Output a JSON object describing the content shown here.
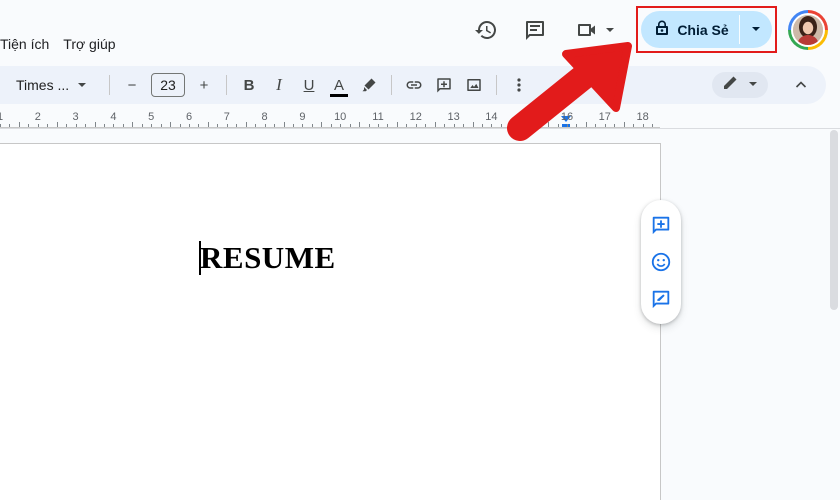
{
  "menu": {
    "items": [
      "Tiện ích",
      "Trợ giúp"
    ]
  },
  "header": {
    "history_icon": "history-icon",
    "comment_icon": "comment-icon",
    "meet_icon": "video-call-icon",
    "share_label": "Chia Sẻ",
    "share_icon": "lock-icon",
    "avatar_icon": "user-avatar"
  },
  "toolbar": {
    "font_name": "Times ...",
    "font_size": "23",
    "decrease_label": "−",
    "increase_label": "+",
    "bold_label": "B",
    "italic_label": "I",
    "underline_label": "U",
    "text_color_label": "A",
    "icons": [
      "highlighter-icon",
      "link-icon",
      "add-comment-icon",
      "image-icon",
      "more-vert-icon",
      "edit-mode-icon",
      "collapse-icon"
    ]
  },
  "ruler": {
    "labels": [
      "1",
      "2",
      "3",
      "4",
      "5",
      "6",
      "7",
      "8",
      "9",
      "10",
      "11",
      "12",
      "13",
      "14",
      "15",
      "16",
      "17",
      "18"
    ]
  },
  "document": {
    "text": "RESUME"
  },
  "side_actions": [
    "add-comment-icon",
    "emoji-reaction-icon",
    "suggest-edit-icon"
  ],
  "colors": {
    "share_bg": "#c2e7ff",
    "highlight_border": "#e21b1b",
    "arrow": "#e21b1b",
    "accent": "#1a73e8"
  }
}
